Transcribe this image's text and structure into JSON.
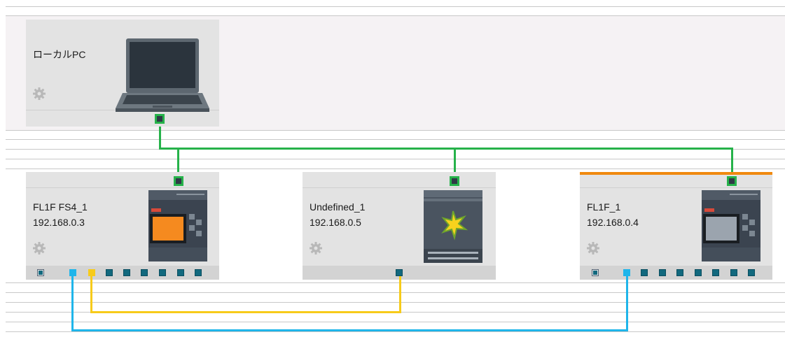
{
  "devices": {
    "local_pc": {
      "name": "ローカルPC"
    },
    "fl1f_fs4": {
      "name": "FL1F FS4_1",
      "ip": "192.168.0.3"
    },
    "undefined": {
      "name": "Undefined_1",
      "ip": "192.168.0.5"
    },
    "fl1f": {
      "name": "FL1F_1",
      "ip": "192.168.0.4",
      "status_color": "#f0890f"
    }
  },
  "colors": {
    "ethernet_link": "#26b24a",
    "link_cyan": "#1fb5ea",
    "link_yellow": "#f7cb1a",
    "port_teal": "#12697e"
  },
  "icons": [
    "laptop-icon",
    "plc-icon",
    "module-icon",
    "gear-icon",
    "ethernet-port-icon"
  ]
}
